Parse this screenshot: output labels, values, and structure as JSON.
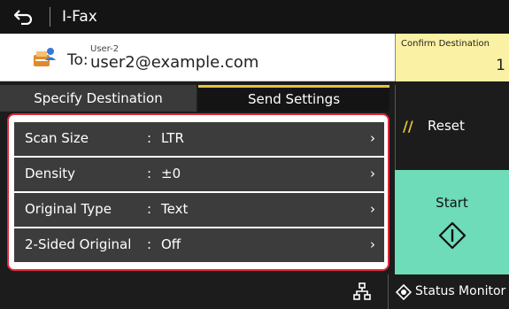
{
  "header": {
    "title": "I-Fax"
  },
  "destination": {
    "to_label": "To:",
    "user_name": "User-2",
    "email": "user2@example.com",
    "confirm_label": "Confirm Destination",
    "confirm_count": "1"
  },
  "tabs": [
    {
      "label": "Specify Destination",
      "selected": false
    },
    {
      "label": "Send Settings",
      "selected": true
    }
  ],
  "settings": [
    {
      "label": "Scan Size",
      "value": "LTR"
    },
    {
      "label": "Density",
      "value": "±0"
    },
    {
      "label": "Original Type",
      "value": "Text"
    },
    {
      "label": "2-Sided Original",
      "value": "Off"
    }
  ],
  "separator": ":",
  "actions": {
    "reset_label": "Reset",
    "start_label": "Start"
  },
  "footer": {
    "status_label": "Status Monitor"
  },
  "colors": {
    "accent_yellow": "#e8c43a",
    "start_green": "#6edbb9",
    "confirm_bg": "#fbf1a4",
    "highlight_red": "#e0283b"
  },
  "icons": {
    "back": "back-arrow-icon",
    "destination": "fax-user-icon",
    "reset": "reset-icon",
    "start": "start-diamond-icon",
    "network": "network-icon",
    "status": "status-monitor-icon"
  }
}
